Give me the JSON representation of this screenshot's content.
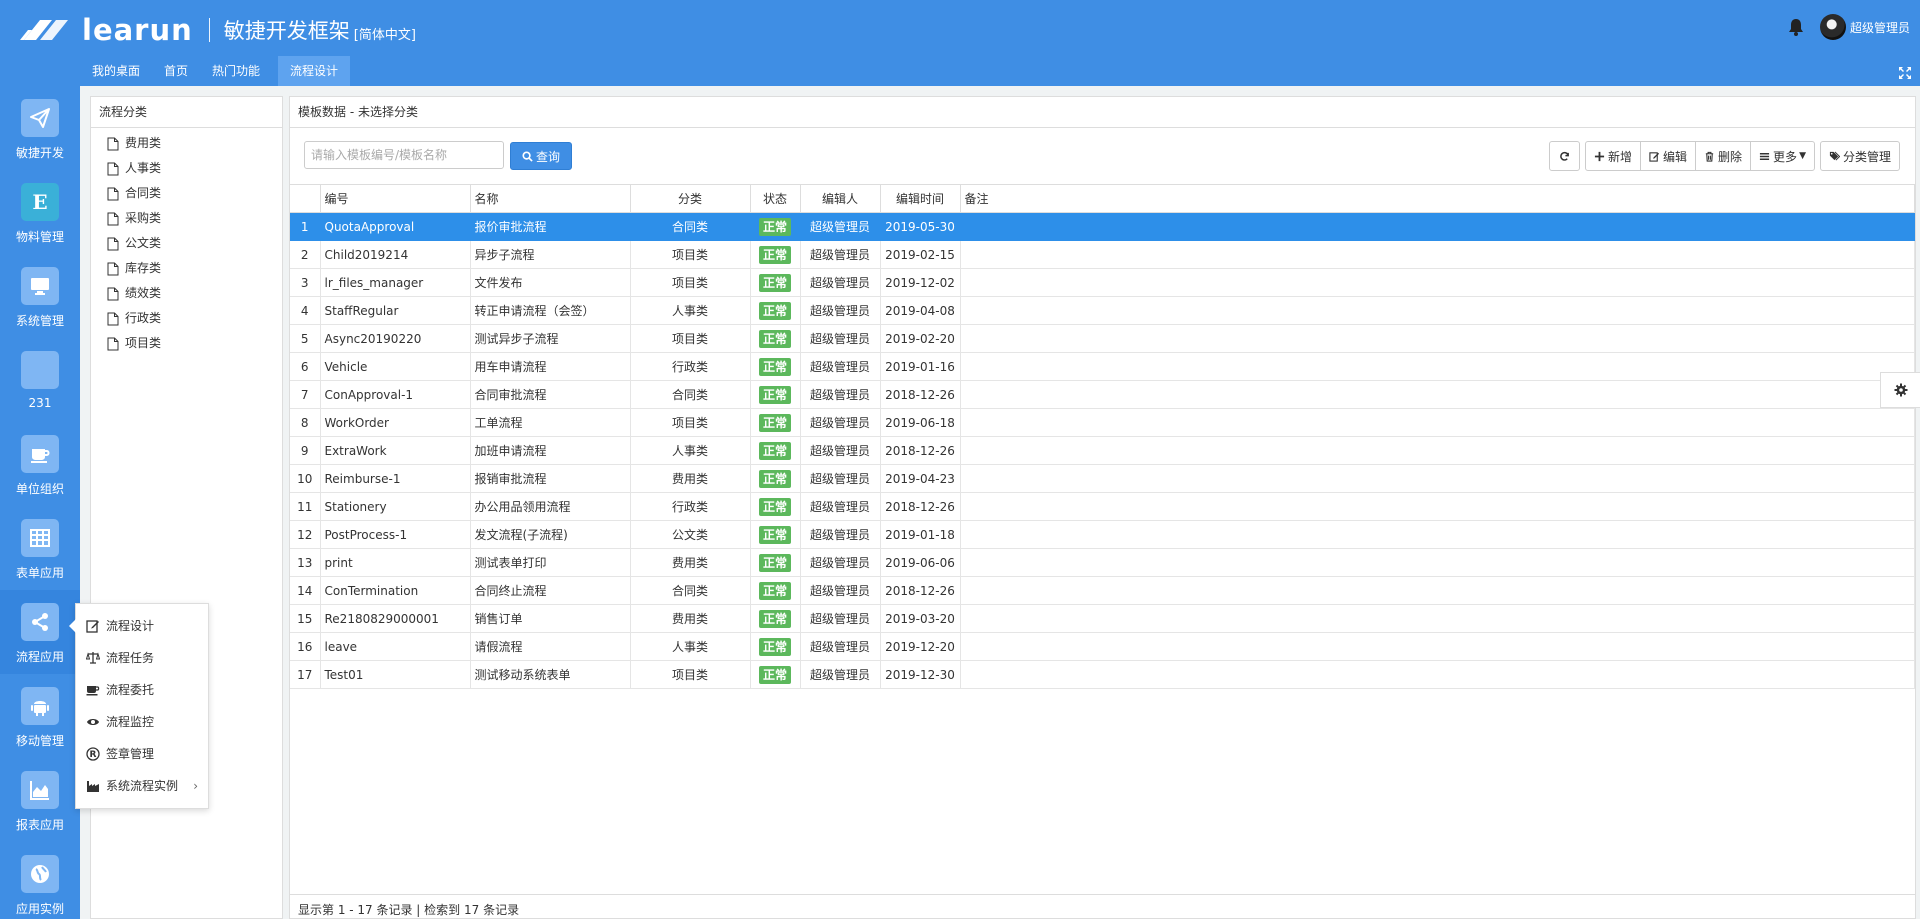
{
  "header": {
    "brand": "learun",
    "subtitle": "敏捷开发框架",
    "language": "[简体中文]",
    "username": "超级管理员"
  },
  "top_nav": {
    "tabs": [
      {
        "label": "我的桌面"
      },
      {
        "label": "首页"
      },
      {
        "label": "热门功能"
      },
      {
        "label": "流程设计",
        "active": true
      }
    ]
  },
  "sidebar": {
    "items": [
      {
        "label": "敏捷开发",
        "icon": "paper-plane-icon"
      },
      {
        "label": "物料管理",
        "icon": "letter-e-icon"
      },
      {
        "label": "系统管理",
        "icon": "monitor-icon"
      },
      {
        "label": "231",
        "icon": "blank-icon"
      },
      {
        "label": "单位组织",
        "icon": "coffee-icon"
      },
      {
        "label": "表单应用",
        "icon": "table-icon"
      },
      {
        "label": "流程应用",
        "icon": "share-icon",
        "active": true
      },
      {
        "label": "移动管理",
        "icon": "android-icon"
      },
      {
        "label": "报表应用",
        "icon": "area-chart-icon"
      },
      {
        "label": "应用实例",
        "icon": "globe-icon"
      }
    ]
  },
  "flyout": {
    "items": [
      {
        "label": "流程设计",
        "icon": "edit-icon"
      },
      {
        "label": "流程任务",
        "icon": "scale-icon"
      },
      {
        "label": "流程委托",
        "icon": "coffee-icon"
      },
      {
        "label": "流程监控",
        "icon": "eye-icon"
      },
      {
        "label": "签章管理",
        "icon": "registered-icon"
      },
      {
        "label": "系统流程实例",
        "icon": "industry-icon",
        "has_submenu": true
      }
    ]
  },
  "tree": {
    "title": "流程分类",
    "items": [
      "费用类",
      "人事类",
      "合同类",
      "采购类",
      "公文类",
      "库存类",
      "绩效类",
      "行政类",
      "项目类"
    ]
  },
  "main": {
    "title": "模板数据 - 未选择分类",
    "search_placeholder": "请输入模板编号/模板名称",
    "query_label": "查询",
    "buttons": {
      "add": "新增",
      "edit": "编辑",
      "delete": "删除",
      "more": "更多",
      "category": "分类管理"
    },
    "columns": [
      "编号",
      "名称",
      "分类",
      "状态",
      "编辑人",
      "编辑时间",
      "备注"
    ],
    "rows": [
      {
        "idx": "1",
        "code": "QuotaApproval",
        "name": "报价审批流程",
        "category": "合同类",
        "status": "正常",
        "editor": "超级管理员",
        "time": "2019-05-30",
        "remark": ""
      },
      {
        "idx": "2",
        "code": "Child2019214",
        "name": "异步子流程",
        "category": "项目类",
        "status": "正常",
        "editor": "超级管理员",
        "time": "2019-02-15",
        "remark": ""
      },
      {
        "idx": "3",
        "code": "lr_files_manager",
        "name": "文件发布",
        "category": "项目类",
        "status": "正常",
        "editor": "超级管理员",
        "time": "2019-12-02",
        "remark": ""
      },
      {
        "idx": "4",
        "code": "StaffRegular",
        "name": "转正申请流程（会签）",
        "category": "人事类",
        "status": "正常",
        "editor": "超级管理员",
        "time": "2019-04-08",
        "remark": ""
      },
      {
        "idx": "5",
        "code": "Async20190220",
        "name": "测试异步子流程",
        "category": "项目类",
        "status": "正常",
        "editor": "超级管理员",
        "time": "2019-02-20",
        "remark": ""
      },
      {
        "idx": "6",
        "code": "Vehicle",
        "name": "用车申请流程",
        "category": "行政类",
        "status": "正常",
        "editor": "超级管理员",
        "time": "2019-01-16",
        "remark": ""
      },
      {
        "idx": "7",
        "code": "ConApproval-1",
        "name": "合同审批流程",
        "category": "合同类",
        "status": "正常",
        "editor": "超级管理员",
        "time": "2018-12-26",
        "remark": ""
      },
      {
        "idx": "8",
        "code": "WorkOrder",
        "name": "工单流程",
        "category": "项目类",
        "status": "正常",
        "editor": "超级管理员",
        "time": "2019-06-18",
        "remark": ""
      },
      {
        "idx": "9",
        "code": "ExtraWork",
        "name": "加班申请流程",
        "category": "人事类",
        "status": "正常",
        "editor": "超级管理员",
        "time": "2018-12-26",
        "remark": ""
      },
      {
        "idx": "10",
        "code": "Reimburse-1",
        "name": "报销审批流程",
        "category": "费用类",
        "status": "正常",
        "editor": "超级管理员",
        "time": "2019-04-23",
        "remark": ""
      },
      {
        "idx": "11",
        "code": "Stationery",
        "name": "办公用品领用流程",
        "category": "行政类",
        "status": "正常",
        "editor": "超级管理员",
        "time": "2018-12-26",
        "remark": ""
      },
      {
        "idx": "12",
        "code": "PostProcess-1",
        "name": "发文流程(子流程)",
        "category": "公文类",
        "status": "正常",
        "editor": "超级管理员",
        "time": "2019-01-18",
        "remark": ""
      },
      {
        "idx": "13",
        "code": "print",
        "name": "测试表单打印",
        "category": "费用类",
        "status": "正常",
        "editor": "超级管理员",
        "time": "2019-06-06",
        "remark": ""
      },
      {
        "idx": "14",
        "code": "ConTermination",
        "name": "合同终止流程",
        "category": "合同类",
        "status": "正常",
        "editor": "超级管理员",
        "time": "2018-12-26",
        "remark": ""
      },
      {
        "idx": "15",
        "code": "Re2180829000001",
        "name": "销售订单",
        "category": "费用类",
        "status": "正常",
        "editor": "超级管理员",
        "time": "2019-03-20",
        "remark": ""
      },
      {
        "idx": "16",
        "code": "leave",
        "name": "请假流程",
        "category": "人事类",
        "status": "正常",
        "editor": "超级管理员",
        "time": "2019-12-20",
        "remark": ""
      },
      {
        "idx": "17",
        "code": "Test01",
        "name": "测试移动系统表单",
        "category": "项目类",
        "status": "正常",
        "editor": "超级管理员",
        "time": "2019-12-30",
        "remark": ""
      }
    ],
    "footer": "显示第 1 - 17 条记录 | 检索到 17 条记录"
  },
  "colors": {
    "primary": "#3f8ee4",
    "selected_row": "#2d8fe9",
    "status_green": "#5cb85c"
  }
}
